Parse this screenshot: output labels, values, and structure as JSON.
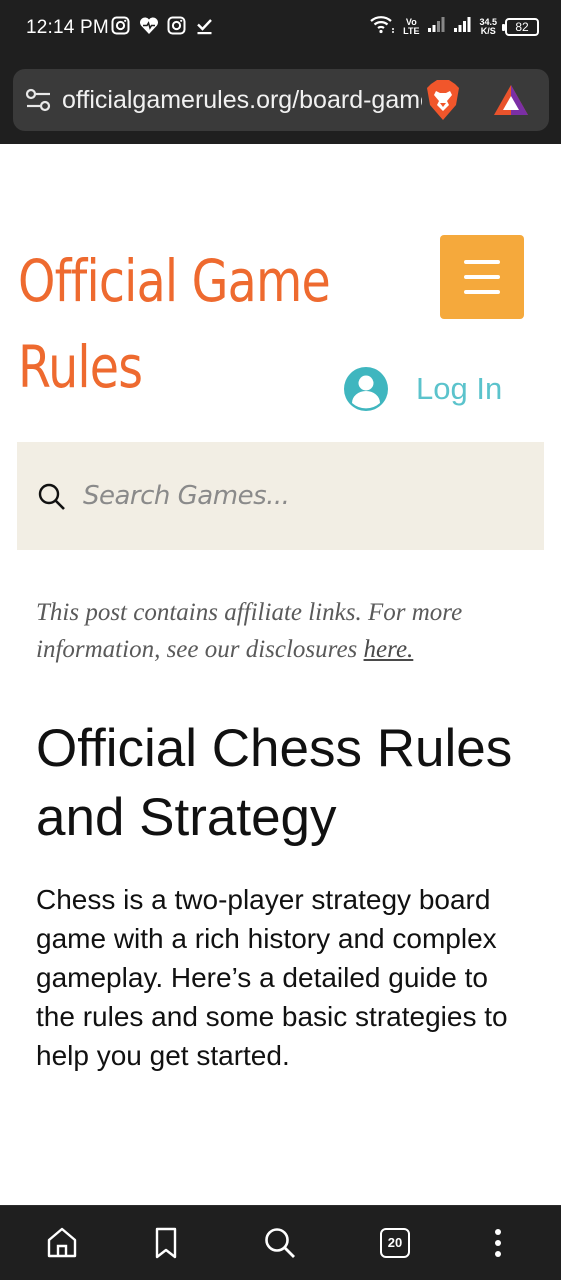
{
  "status_bar": {
    "time": "12:14 PM",
    "network_speed_value": "34.5",
    "network_speed_unit": "K/S",
    "volte_top": "Vo",
    "volte_bottom": "LTE",
    "battery": "82",
    "left_icons": [
      "instagram-icon",
      "heart-icon",
      "instagram-icon",
      "download-done-icon"
    ],
    "right_icons": [
      "wifi-icon",
      "signal-icon",
      "signal-icon",
      "battery-icon"
    ]
  },
  "browser": {
    "url": "officialgamerules.org/board-games/chess",
    "icons": [
      "site-settings-icon",
      "brave-shields-icon",
      "brave-rewards-icon"
    ]
  },
  "header": {
    "site_title_line1": "Official Game",
    "site_title_line2": "Rules",
    "login_label": "Log In",
    "menu_icon": "hamburger-icon"
  },
  "search": {
    "placeholder": "Search Games..."
  },
  "notice": {
    "text": "This post contains affiliate links. For more information, see our disclosures ",
    "link_text": "here."
  },
  "article": {
    "title": "Official Chess Rules and Strategy",
    "intro": "Chess is a two-player strategy board game with a rich history and complex gameplay. Here’s a detailed guide to the rules and some basic strategies to help you get started."
  },
  "bottom_nav": {
    "tab_count": "20",
    "icons": [
      "home-icon",
      "bookmark-icon",
      "search-icon",
      "tabs-icon",
      "more-vert-icon"
    ]
  },
  "colors": {
    "brand_orange": "#ee6a2f",
    "menu_button": "#f5a93c",
    "login_teal": "#5bc3cc",
    "search_bg": "#f2eee4",
    "chrome_dark": "#1f1f1f"
  }
}
